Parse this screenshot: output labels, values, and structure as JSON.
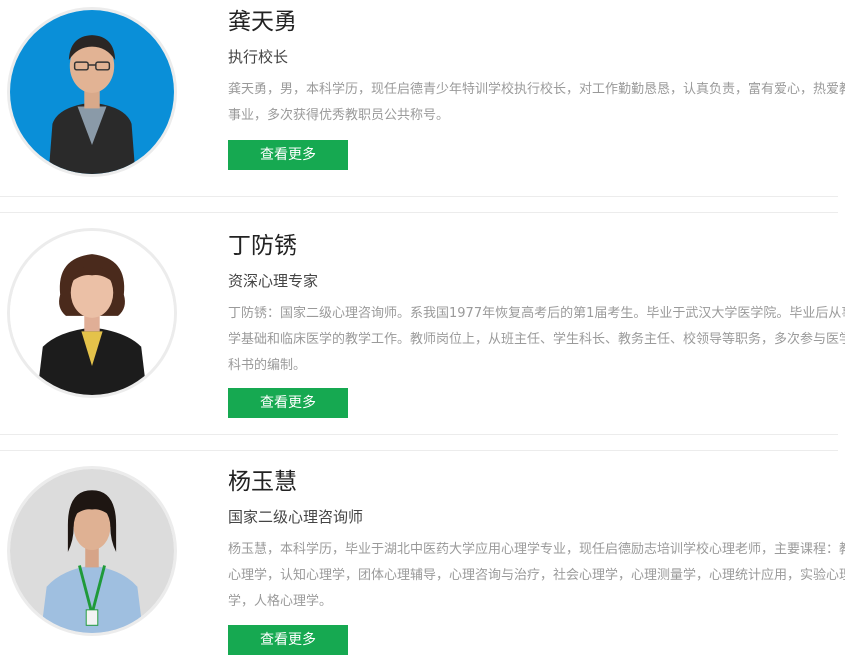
{
  "teachers": [
    {
      "name": "龚天勇",
      "title": "执行校长",
      "description": "龚天勇，男，本科学历，现任启德青少年特训学校执行校长，对工作勤勤恳恳，认真负责，富有爱心，热爱教育事业，多次获得优秀教职员公共称号。",
      "button_label": "查看更多"
    },
    {
      "name": "丁防锈",
      "title": "资深心理专家",
      "description": "丁防锈：国家二级心理咨询师。系我国1977年恢复高考后的第1届考生。毕业于武汉大学医学院。毕业后从事医学基础和临床医学的教学工作。教师岗位上，从班主任、学生科长、教务主任、校领导等职务，多次参与医学教科书的编制。",
      "button_label": "查看更多"
    },
    {
      "name": "杨玉慧",
      "title": "国家二级心理咨询师",
      "description": "杨玉慧，本科学历，毕业于湖北中医药大学应用心理学专业，现任启德励志培训学校心理老师，主要课程：教育心理学，认知心理学，团体心理辅导，心理咨询与治疗，社会心理学，心理测量学，心理统计应用，实验心理学，人格心理学。",
      "button_label": "查看更多"
    }
  ],
  "colors": {
    "button_green": "#16a951",
    "avatar_bg_1": "#0a8fd8",
    "avatar_bg_2": "#ffffff",
    "avatar_bg_3": "#dcdcdc"
  }
}
